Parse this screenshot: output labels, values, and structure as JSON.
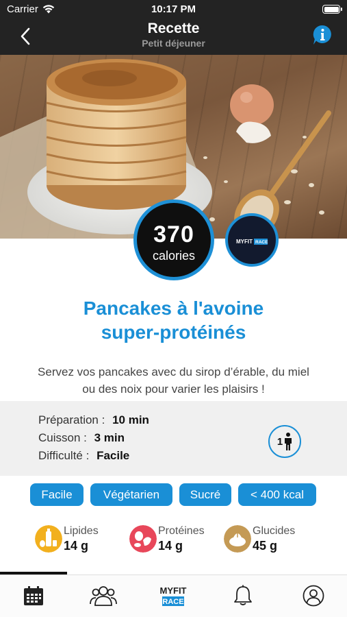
{
  "status_bar": {
    "carrier": "Carrier",
    "time": "10:17 PM"
  },
  "nav": {
    "title": "Recette",
    "subtitle": "Petit déjeuner"
  },
  "recipe": {
    "calories_value": "370",
    "calories_unit": "calories",
    "brand_badge": "MYFIT RACE",
    "title_line1": "Pancakes à l'avoine",
    "title_line2": "super-protéinés",
    "description_line1": "Servez vos pancakes avec du sirop d’érable, du miel",
    "description_line2": "ou des noix pour varier les plaisirs !"
  },
  "info": {
    "preparation_label": "Préparation :",
    "preparation_value": "10 min",
    "cuisson_label": "Cuisson :",
    "cuisson_value": "3 min",
    "difficulte_label": "Difficulté :",
    "difficulte_value": "Facile",
    "servings": "1"
  },
  "tags": [
    "Facile",
    "Végétarien",
    "Sucré",
    "< 400 kcal"
  ],
  "macros": [
    {
      "label": "Lipides",
      "value": "14 g",
      "color": "#f2b01e"
    },
    {
      "label": "Protéines",
      "value": "14 g",
      "color": "#e8475a"
    },
    {
      "label": "Glucides",
      "value": "45 g",
      "color": "#c49a55"
    }
  ],
  "tabbar": {
    "items": [
      "calendar-icon",
      "community-icon",
      "myfit-race-logo",
      "bell-icon",
      "profile-icon"
    ],
    "logo_top": "MYFIT",
    "logo_bottom": "RACE"
  },
  "colors": {
    "accent": "#1a8fd6",
    "bar": "#232323"
  }
}
